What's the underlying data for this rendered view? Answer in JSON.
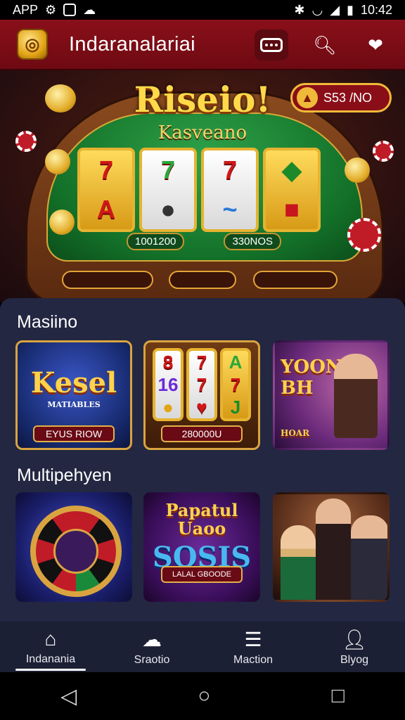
{
  "status_bar": {
    "left_label": "APP",
    "time": "10:42"
  },
  "app_bar": {
    "title": "Indaranalariai"
  },
  "hero": {
    "title": "Riseio!",
    "subtitle": "Kasveano",
    "coin_label": "S53 /NO",
    "reel_left_label": "1001200",
    "reel_right_label": "330NOS"
  },
  "sections": [
    {
      "title": "Masiino",
      "cards": [
        {
          "title": "Kesel",
          "subtitle": "MATIABLES",
          "banner": "EYUS RIOW"
        },
        {
          "title": "",
          "subtitle": "",
          "banner": "280000U"
        },
        {
          "title": "YOON BH",
          "subtitle": "HOAR",
          "banner": ""
        }
      ]
    },
    {
      "title": "Multipehyen",
      "cards": [
        {
          "title": "",
          "subtitle": "",
          "banner": ""
        },
        {
          "title": "Papatul Uaoo",
          "subtitle": "SOSIS",
          "banner": "LALAL GBOODE"
        },
        {
          "title": "",
          "subtitle": "",
          "banner": ""
        }
      ]
    }
  ],
  "bottom_nav": [
    {
      "label": "Indanania",
      "icon": "home-icon",
      "active": true
    },
    {
      "label": "Sraotio",
      "icon": "chat-bubble-icon",
      "active": false
    },
    {
      "label": "Maction",
      "icon": "message-icon",
      "active": false
    },
    {
      "label": "Blyog",
      "icon": "user-icon",
      "active": false
    }
  ],
  "colors": {
    "app_bar": "#8a0f1a",
    "panel": "#232741",
    "gold": "#d9a440",
    "bottom_nav": "#1c2034"
  }
}
